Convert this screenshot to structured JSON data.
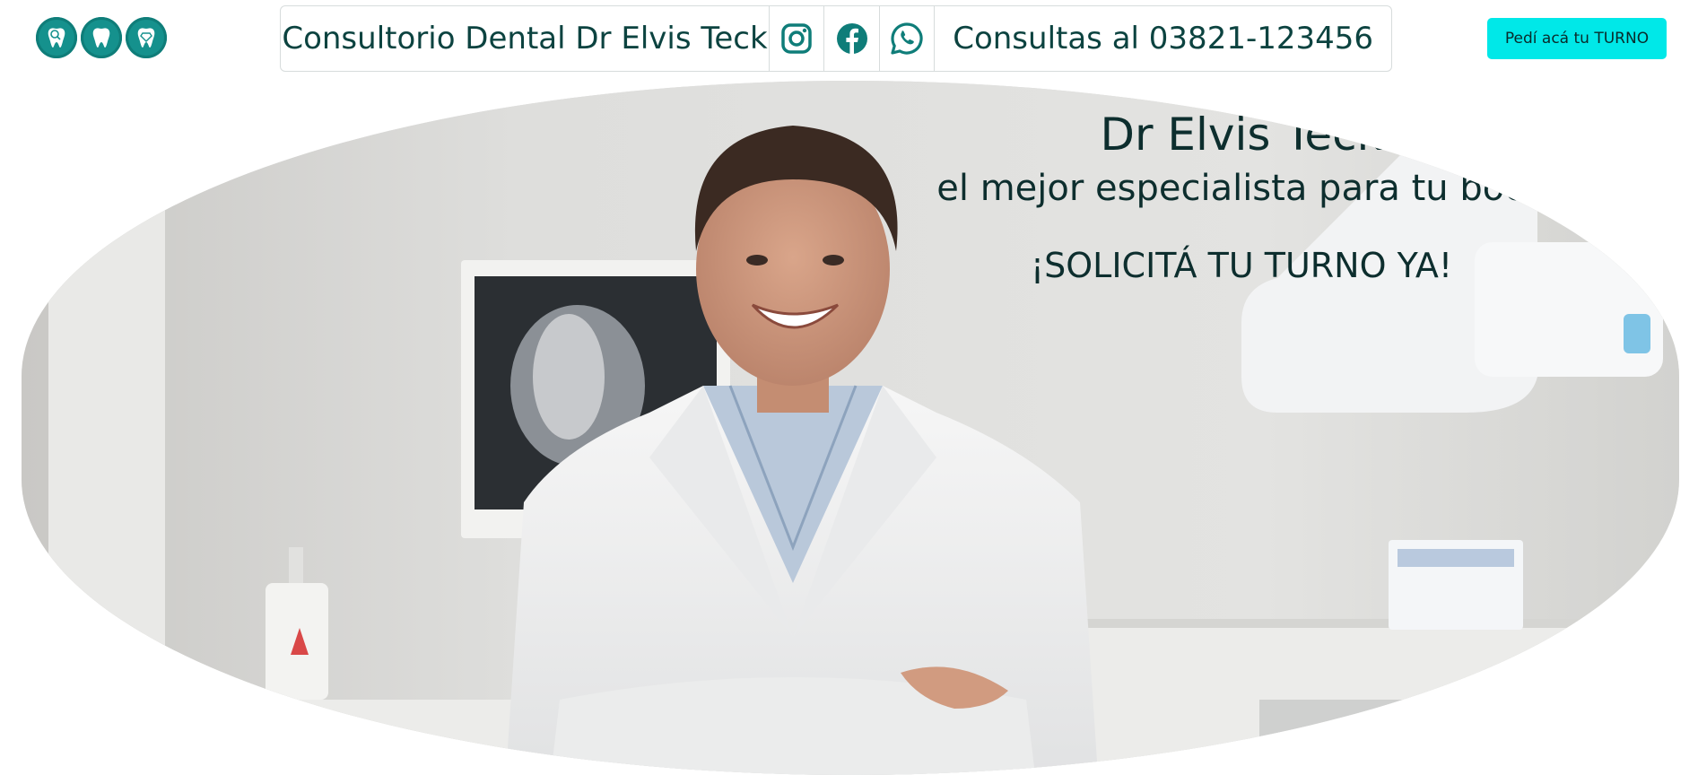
{
  "header": {
    "logo_icons": [
      "tooth-magnifier-icon",
      "tooth-icon",
      "tooth-diamond-icon"
    ],
    "title": "Consultorio Dental Dr Elvis Teck",
    "social_icons": [
      "instagram-icon",
      "facebook-icon",
      "whatsapp-icon"
    ],
    "phone_text": "Consultas al 03821-123456",
    "cta_button": "Pedí acá tu TURNO"
  },
  "hero": {
    "name": "Dr Elvis Teck",
    "tagline": "el mejor especialista para tu boca",
    "cta": "¡SOLICITÁ TU TURNO YA!"
  },
  "colors": {
    "brand_teal": "#15918d",
    "text_dark_teal": "#0c4340",
    "cta_cyan": "#00e8e8"
  }
}
